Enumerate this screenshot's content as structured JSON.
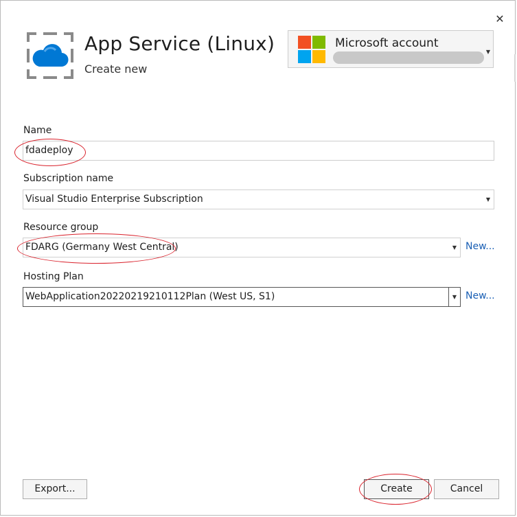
{
  "dialog": {
    "close_glyph": "✕"
  },
  "header": {
    "title": "App Service (Linux)",
    "subtitle": "Create new",
    "icon": "app-service-cloud-icon"
  },
  "account": {
    "name": "Microsoft account",
    "logo": "microsoft-logo",
    "colors": [
      "#f25022",
      "#7fba00",
      "#00a4ef",
      "#ffb900"
    ],
    "caret": "▼"
  },
  "form": {
    "name": {
      "label": "Name",
      "value": "fdadeploy"
    },
    "subscription": {
      "label": "Subscription name",
      "value": "Visual Studio Enterprise Subscription"
    },
    "resource_group": {
      "label": "Resource group",
      "value": "FDARG (Germany West Central)",
      "new_link": "New..."
    },
    "hosting_plan": {
      "label": "Hosting Plan",
      "value": "WebApplication20220219210112Plan (West US, S1)",
      "new_link": "New..."
    },
    "caret": "▼"
  },
  "footer": {
    "export_label": "Export...",
    "create_label": "Create",
    "cancel_label": "Cancel"
  },
  "colors": {
    "annotation": "#d9202a",
    "link": "#1a5fb4",
    "cloud": "#0078d4"
  }
}
